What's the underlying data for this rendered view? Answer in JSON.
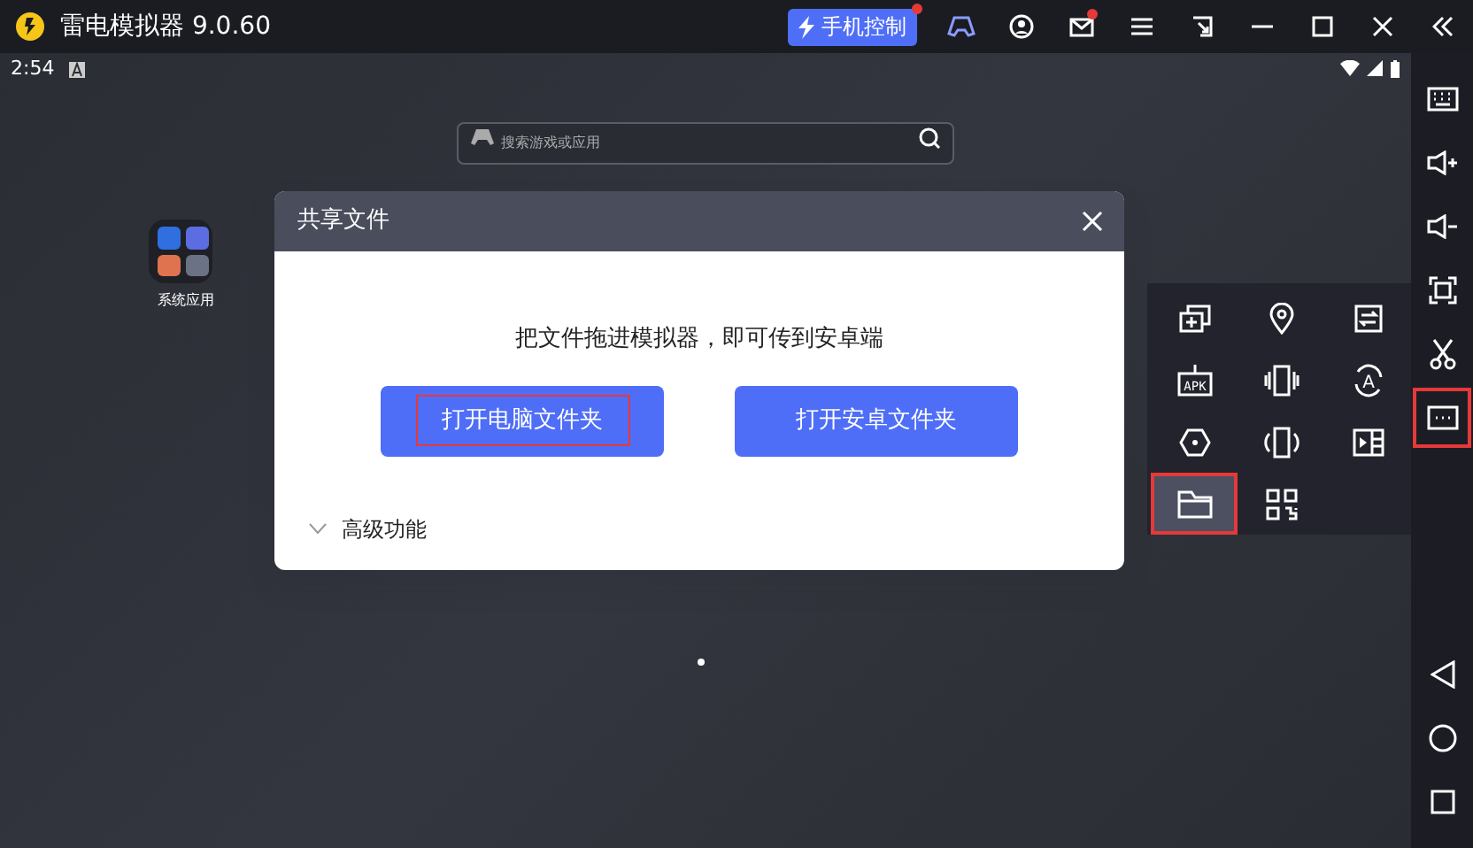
{
  "window": {
    "title": "雷电模拟器 9.0.60",
    "phone_control": {
      "label": "手机控制",
      "notification": true
    },
    "controls": [
      {
        "kind": "gamepad",
        "notification": false
      },
      {
        "kind": "user",
        "notification": false
      },
      {
        "kind": "mail",
        "notification": true
      },
      {
        "kind": "menu",
        "notification": false
      },
      {
        "kind": "window",
        "notification": false
      },
      {
        "kind": "minimize",
        "notification": false
      },
      {
        "kind": "maximize",
        "notification": false
      },
      {
        "kind": "close",
        "notification": false
      },
      {
        "kind": "collapse",
        "notification": false
      }
    ]
  },
  "status_bar": {
    "time": "2:54"
  },
  "search": {
    "placeholder": "搜索游戏或应用"
  },
  "desktop_icons": [
    {
      "label": "系统应用"
    }
  ],
  "dialog": {
    "title": "共享文件",
    "message": "把文件拖进模拟器，即可传到安卓端",
    "buttons": [
      {
        "label": "打开电脑文件夹",
        "highlighted": true
      },
      {
        "label": "打开安卓文件夹",
        "highlighted": false
      }
    ],
    "advanced": {
      "label": "高级功能",
      "expanded": false
    }
  },
  "tools": [
    {
      "kind": "multi-window",
      "selected": false,
      "highlighted": false
    },
    {
      "kind": "location",
      "selected": false,
      "highlighted": false
    },
    {
      "kind": "sync",
      "selected": false,
      "highlighted": false
    },
    {
      "kind": "apk",
      "glyph": "APK",
      "selected": false,
      "highlighted": false
    },
    {
      "kind": "shake",
      "selected": false,
      "highlighted": false
    },
    {
      "kind": "rotate",
      "glyph": "A",
      "selected": false,
      "highlighted": false
    },
    {
      "kind": "hexagon",
      "selected": false,
      "highlighted": false
    },
    {
      "kind": "rotate-screen",
      "selected": false,
      "highlighted": false
    },
    {
      "kind": "video",
      "selected": false,
      "highlighted": false
    },
    {
      "kind": "folder",
      "selected": true,
      "highlighted": true
    },
    {
      "kind": "qr",
      "selected": false,
      "highlighted": false
    }
  ],
  "sidebar": [
    {
      "kind": "keyboard",
      "highlighted": false
    },
    {
      "kind": "volume-up",
      "highlighted": false
    },
    {
      "kind": "volume-down",
      "highlighted": false
    },
    {
      "kind": "fullscreen",
      "highlighted": false
    },
    {
      "kind": "scissors",
      "highlighted": false
    },
    {
      "kind": "more",
      "highlighted": true
    },
    {
      "kind": "back",
      "highlighted": false
    },
    {
      "kind": "home",
      "highlighted": false
    },
    {
      "kind": "recents",
      "highlighted": false
    }
  ]
}
